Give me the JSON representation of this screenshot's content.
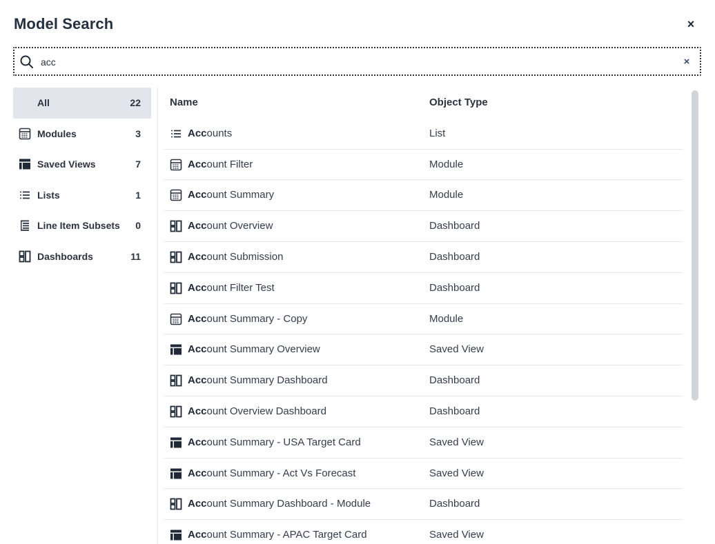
{
  "dialog": {
    "title": "Model Search",
    "close_label": "×"
  },
  "search": {
    "value": "acc",
    "placeholder": "",
    "clear_label": "×"
  },
  "sidebar": {
    "items": [
      {
        "label": "All",
        "count": "22",
        "icon": "none",
        "active": true
      },
      {
        "label": "Modules",
        "count": "3",
        "icon": "module-icon"
      },
      {
        "label": "Saved Views",
        "count": "7",
        "icon": "saved-view-icon"
      },
      {
        "label": "Lists",
        "count": "1",
        "icon": "list-icon"
      },
      {
        "label": "Line Item Subsets",
        "count": "0",
        "icon": "line-item-subset-icon"
      },
      {
        "label": "Dashboards",
        "count": "11",
        "icon": "dashboard-icon"
      }
    ]
  },
  "table": {
    "columns": [
      "Name",
      "Object Type"
    ],
    "rows": [
      {
        "match": "Acc",
        "rest": "ounts",
        "type": "List",
        "icon": "list-icon"
      },
      {
        "match": "Acc",
        "rest": "ount Filter",
        "type": "Module",
        "icon": "module-icon"
      },
      {
        "match": "Acc",
        "rest": "ount Summary",
        "type": "Module",
        "icon": "module-icon"
      },
      {
        "match": "Acc",
        "rest": "ount Overview",
        "type": "Dashboard",
        "icon": "dashboard-icon"
      },
      {
        "match": "Acc",
        "rest": "ount Submission",
        "type": "Dashboard",
        "icon": "dashboard-icon"
      },
      {
        "match": "Acc",
        "rest": "ount Filter Test",
        "type": "Dashboard",
        "icon": "dashboard-icon"
      },
      {
        "match": "Acc",
        "rest": "ount Summary - Copy",
        "type": "Module",
        "icon": "module-icon"
      },
      {
        "match": "Acc",
        "rest": "ount Summary Overview",
        "type": "Saved View",
        "icon": "saved-view-icon"
      },
      {
        "match": "Acc",
        "rest": "ount Summary Dashboard",
        "type": "Dashboard",
        "icon": "dashboard-icon"
      },
      {
        "match": "Acc",
        "rest": "ount Overview Dashboard",
        "type": "Dashboard",
        "icon": "dashboard-icon"
      },
      {
        "match": "Acc",
        "rest": "ount Summary - USA Target Card",
        "type": "Saved View",
        "icon": "saved-view-icon"
      },
      {
        "match": "Acc",
        "rest": "ount Summary - Act Vs Forecast",
        "type": "Saved View",
        "icon": "saved-view-icon"
      },
      {
        "match": "Acc",
        "rest": "ount Summary Dashboard - Module",
        "type": "Dashboard",
        "icon": "dashboard-icon"
      },
      {
        "match": "Acc",
        "rest": "ount Summary - APAC Target Card",
        "type": "Saved View",
        "icon": "saved-view-icon"
      }
    ]
  }
}
